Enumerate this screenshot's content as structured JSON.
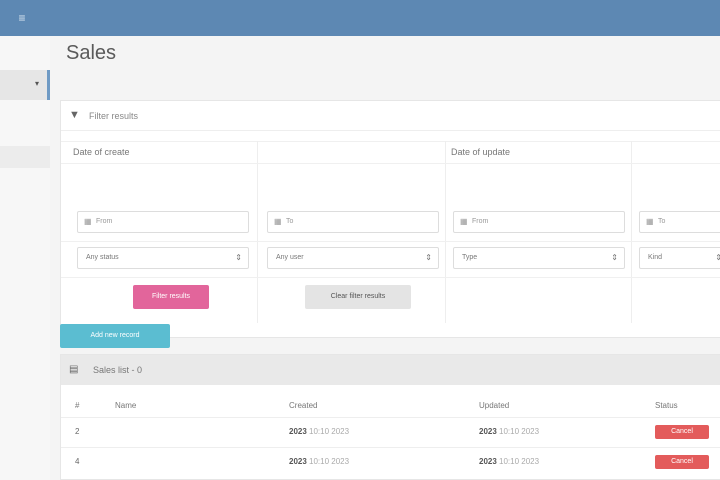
{
  "topbar": {
    "menu_icon": "hamburger-icon",
    "menu_glyph": "≡"
  },
  "sidebar": {
    "active_chevron": "▾"
  },
  "page": {
    "title": "Sales"
  },
  "filter": {
    "header_icon": "funnel-icon",
    "header_label": "Filter results",
    "section_left": "Date of create",
    "section_right": "Date of update",
    "inputs": [
      {
        "icon": "calendar-icon",
        "placeholder": "From"
      },
      {
        "icon": "calendar-icon",
        "placeholder": "To"
      },
      {
        "icon": "calendar-icon",
        "placeholder": "From"
      },
      {
        "icon": "calendar-icon",
        "placeholder": "To"
      }
    ],
    "selects": [
      {
        "value": "Any status"
      },
      {
        "value": "Any user"
      },
      {
        "value": "Type"
      },
      {
        "value": "Kind"
      }
    ],
    "filter_button": "Filter results",
    "clear_button": "Clear filter results"
  },
  "add_button": "Add new record",
  "table": {
    "header_icon": "table-icon",
    "header_label": "Sales list - 0",
    "columns": [
      "#",
      "Name",
      "Created",
      "Updated",
      "Status"
    ],
    "rows": [
      {
        "num": "2",
        "name": "",
        "created_strong": "2023",
        "created_sub": "10:10 2023",
        "updated_strong": "2023",
        "updated_sub": "10:10 2023",
        "status": "Cancel"
      },
      {
        "num": "4",
        "name": "",
        "created_strong": "2023",
        "created_sub": "10:10 2023",
        "updated_strong": "2023",
        "updated_sub": "10:10 2023",
        "status": "Cancel"
      }
    ]
  },
  "colors": {
    "topbar": "#5d88b3",
    "accent_pink": "#e2659b",
    "accent_teal": "#5bbdd1",
    "status_red": "#e35b5b"
  }
}
